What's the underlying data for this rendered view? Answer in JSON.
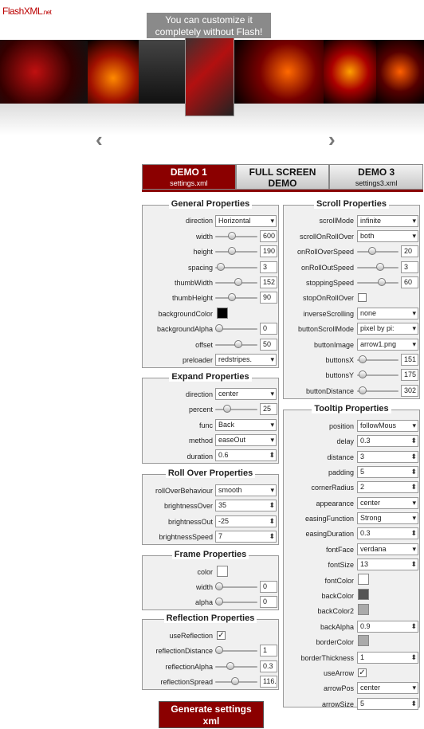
{
  "logo": {
    "main": "FlashXML",
    "suffix": ".net"
  },
  "banner": {
    "tooltip_line1": "You can customize it",
    "tooltip_line2": "completely without Flash!"
  },
  "nav": {
    "prev": "‹",
    "next": "›"
  },
  "tabs": [
    {
      "title": "DEMO 1",
      "sub": "settings.xml"
    },
    {
      "title": "FULL SCREEN",
      "sub": "DEMO"
    },
    {
      "title": "DEMO 3",
      "sub": "settings3.xml"
    }
  ],
  "general": {
    "title": "General Properties",
    "direction": "Horizontal",
    "width": "600",
    "height": "190",
    "spacing": "3",
    "thumbWidth": "152",
    "thumbHeight": "90",
    "backgroundAlpha": "0",
    "offset": "50",
    "preloader": "redstripes.",
    "labels": {
      "direction": "direction",
      "width": "width",
      "height": "height",
      "spacing": "spacing",
      "thumbWidth": "thumbWidth",
      "thumbHeight": "thumbHeight",
      "backgroundColor": "backgroundColor",
      "backgroundAlpha": "backgroundAlpha",
      "offset": "offset",
      "preloader": "preloader"
    }
  },
  "expand": {
    "title": "Expand Properties",
    "direction": "center",
    "percent": "25",
    "func": "Back",
    "method": "easeOut",
    "duration": "0.6",
    "labels": {
      "direction": "direction",
      "percent": "percent",
      "func": "func",
      "method": "method",
      "duration": "duration"
    }
  },
  "rollover": {
    "title": "Roll Over Properties",
    "rollOverBehaviour": "smooth",
    "brightnessOver": "35",
    "brightnessOut": "-25",
    "brightnessSpeed": "7",
    "labels": {
      "rollOverBehaviour": "rollOverBehaviour",
      "brightnessOver": "brightnessOver",
      "brightnessOut": "brightnessOut",
      "brightnessSpeed": "brightnessSpeed"
    }
  },
  "frame": {
    "title": "Frame Properties",
    "width": "0",
    "alpha": "0",
    "labels": {
      "color": "color",
      "width": "width",
      "alpha": "alpha"
    }
  },
  "reflection": {
    "title": "Reflection Properties",
    "useReflection": "✓",
    "reflectionDistance": "1",
    "reflectionAlpha": "0.3",
    "reflectionSpread": "116.",
    "labels": {
      "useReflection": "useReflection",
      "reflectionDistance": "reflectionDistance",
      "reflectionAlpha": "reflectionAlpha",
      "reflectionSpread": "reflectionSpread"
    }
  },
  "scroll": {
    "title": "Scroll Properties",
    "scrollMode": "infinite",
    "scrollOnRollOver": "both",
    "onRollOverSpeed": "20",
    "onRollOutSpeed": "3",
    "stoppingSpeed": "60",
    "inverseScrolling": "none",
    "buttonScrollMode": "pixel by pi:",
    "buttonImage": "arrow1.png",
    "buttonsX": "151",
    "buttonsY": "175",
    "buttonDistance": "302",
    "labels": {
      "scrollMode": "scrollMode",
      "scrollOnRollOver": "scrollOnRollOver",
      "onRollOverSpeed": "onRollOverSpeed",
      "onRollOutSpeed": "onRollOutSpeed",
      "stoppingSpeed": "stoppingSpeed",
      "stopOnRollOver": "stopOnRollOver",
      "inverseScrolling": "inverseScrolling",
      "buttonScrollMode": "buttonScrollMode",
      "buttonImage": "buttonImage",
      "buttonsX": "buttonsX",
      "buttonsY": "buttonsY",
      "buttonDistance": "buttonDistance"
    }
  },
  "tooltipProps": {
    "title": "Tooltip Properties",
    "position": "followMous",
    "delay": "0.3",
    "distance": "3",
    "padding": "5",
    "cornerRadius": "2",
    "appearance": "center",
    "easingFunction": "Strong",
    "easingDuration": "0.3",
    "fontFace": "verdana",
    "fontSize": "13",
    "backAlpha": "0.9",
    "borderThickness": "1",
    "useArrow": "✓",
    "arrowPos": "center",
    "arrowSize": "5",
    "labels": {
      "position": "position",
      "delay": "delay",
      "distance": "distance",
      "padding": "padding",
      "cornerRadius": "cornerRadius",
      "appearance": "appearance",
      "easingFunction": "easingFunction",
      "easingDuration": "easingDuration",
      "fontFace": "fontFace",
      "fontSize": "fontSize",
      "fontColor": "fontColor",
      "backColor": "backColor",
      "backColor2": "backColor2",
      "backAlpha": "backAlpha",
      "borderColor": "borderColor",
      "borderThickness": "borderThickness",
      "useArrow": "useArrow",
      "arrowPos": "arrowPos",
      "arrowSize": "arrowSize"
    }
  },
  "colors": {
    "accent": "#8b0000",
    "black": "#000000",
    "backColor": "#555555",
    "backColor2": "#aaaaaa",
    "borderColor": "#aaaaaa"
  },
  "generate": {
    "line1": "Generate settings",
    "line2": "xml"
  }
}
